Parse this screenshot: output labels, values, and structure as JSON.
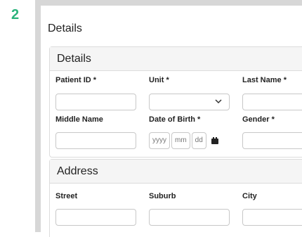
{
  "step": "2",
  "form": {
    "title": "Details",
    "details_card": {
      "header": "Details",
      "fields": {
        "patient_id_label": "Patient ID *",
        "unit_label": "Unit *",
        "last_name_label": "Last Name *",
        "middle_name_label": "Middle Name",
        "dob_label": "Date of Birth *",
        "gender_label": "Gender *"
      },
      "dob": {
        "yyyy": "yyyy",
        "mm": "mm",
        "dd": "dd"
      }
    },
    "address_card": {
      "header": "Address",
      "fields": {
        "street_label": "Street",
        "suburb_label": "Suburb",
        "city_label": "City"
      }
    }
  },
  "icons": {
    "unit_dropdown": "chevron-down-icon",
    "dob_picker": "calendar-icon"
  },
  "colors": {
    "step_accent": "#2cb37c",
    "frame": "#d7d7d7",
    "card_header_bg": "#f5f5f5",
    "border": "#dcdcdc"
  }
}
